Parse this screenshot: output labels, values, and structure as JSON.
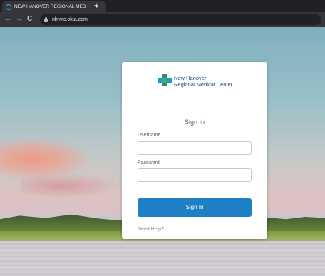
{
  "browser": {
    "tab_title": "NEW HANOVER REGIONAL MED",
    "tab_close": "×",
    "new_tab": "+",
    "back": "←",
    "forward": "→",
    "reload": "C",
    "url": "nhrmc.okta.com"
  },
  "org": {
    "name_line1": "New Hanover",
    "name_line2": "Regional Medical Center",
    "logo_colors": {
      "vertical": "#2a8a8a",
      "horizontal": "#1a9bd4",
      "center": "#3fb14a"
    }
  },
  "signin": {
    "title": "Sign In",
    "username_label": "Username",
    "username_value": "",
    "password_label": "Password",
    "password_value": "",
    "submit_label": "Sign In",
    "help_link": "Need Help?"
  },
  "colors": {
    "primary_button": "#1f7fc4",
    "org_text": "#1f4e79"
  }
}
